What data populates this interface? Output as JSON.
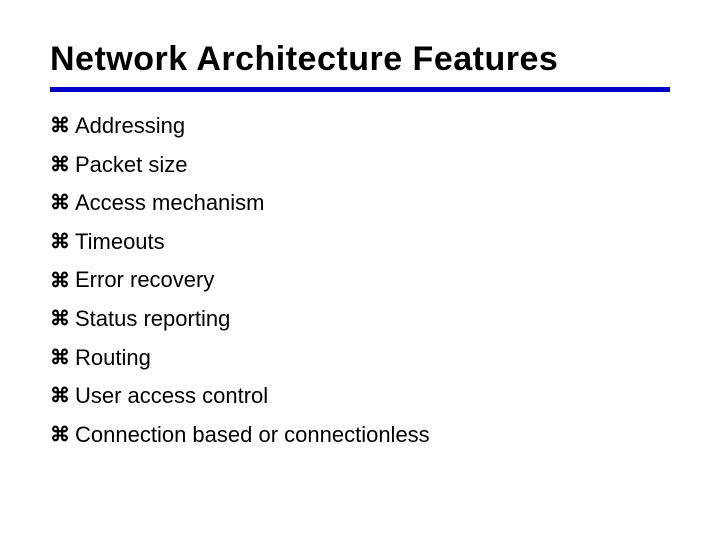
{
  "title": "Network Architecture Features",
  "bullets": [
    "Addressing",
    "Packet size",
    "Access mechanism",
    "Timeouts",
    "Error recovery",
    "Status reporting",
    "Routing",
    "User access control",
    "Connection based or connectionless"
  ],
  "bullet_glyph": "⌘"
}
